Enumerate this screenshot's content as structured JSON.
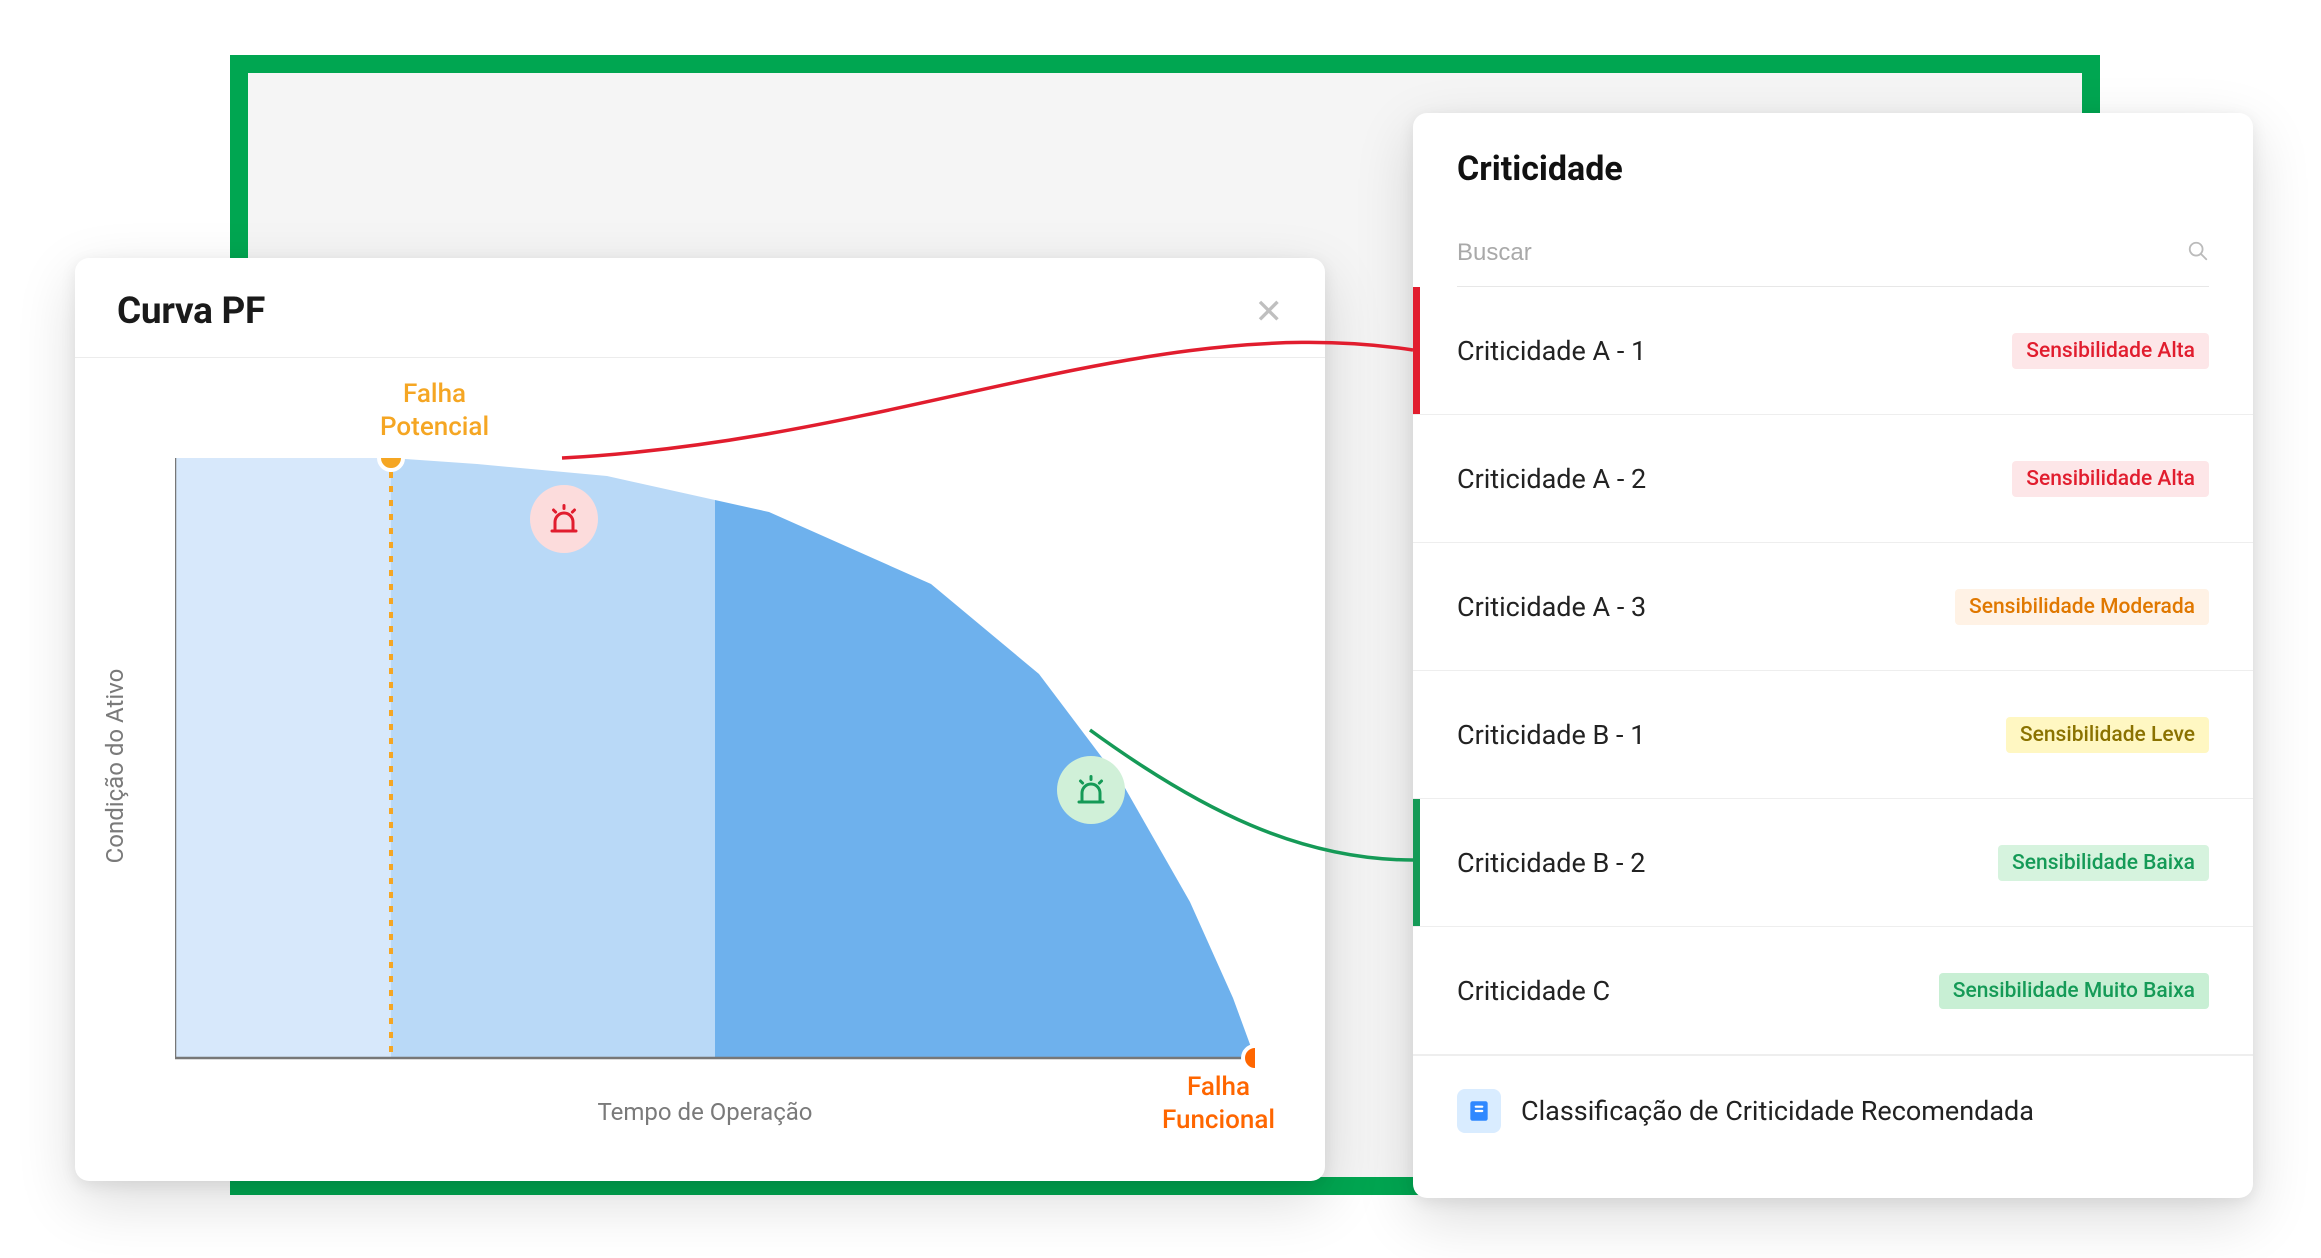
{
  "pf_card": {
    "title": "Curva PF",
    "close_glyph": "✕",
    "potential_failure_label": "Falha\nPotencial",
    "functional_failure_label": "Falha\nFuncional",
    "y_axis_label": "Condição do Ativo",
    "x_axis_label": "Tempo de Operação"
  },
  "criticality": {
    "title": "Criticidade",
    "search_placeholder": "Buscar",
    "items": [
      {
        "label": "Criticidade A - 1",
        "badge": "Sensibilidade Alta",
        "badge_class": "badge-alta",
        "selected_bar": "sel-red"
      },
      {
        "label": "Criticidade A - 2",
        "badge": "Sensibilidade Alta",
        "badge_class": "badge-alta",
        "selected_bar": ""
      },
      {
        "label": "Criticidade A - 3",
        "badge": "Sensibilidade Moderada",
        "badge_class": "badge-mod",
        "selected_bar": ""
      },
      {
        "label": "Criticidade B - 1",
        "badge": "Sensibilidade Leve",
        "badge_class": "badge-leve",
        "selected_bar": ""
      },
      {
        "label": "Criticidade B - 2",
        "badge": "Sensibilidade Baixa",
        "badge_class": "badge-baixa",
        "selected_bar": "sel-green"
      },
      {
        "label": "Criticidade C",
        "badge": "Sensibilidade Muito Baixa",
        "badge_class": "badge-mbaixa",
        "selected_bar": ""
      }
    ],
    "footer_text": "Classificação de Criticidade Recomendada"
  },
  "chart_data": {
    "type": "area",
    "title": "Curva PF",
    "xlabel": "Tempo de Operação",
    "ylabel": "Condição do Ativo",
    "description": "P-F curve: asset condition over operating time, showing potential failure point and functional failure point, with two alert markers.",
    "x_range_normalized": [
      0,
      1
    ],
    "y_range_normalized": [
      0,
      1
    ],
    "series": [
      {
        "name": "Condição do Ativo",
        "x": [
          0.0,
          0.2,
          0.28,
          0.4,
          0.55,
          0.7,
          0.8,
          0.88,
          0.94,
          0.98,
          1.0
        ],
        "y": [
          1.0,
          1.0,
          0.99,
          0.97,
          0.91,
          0.79,
          0.64,
          0.45,
          0.26,
          0.1,
          0.0
        ]
      }
    ],
    "shaded_regions": [
      {
        "x_from": 0.0,
        "x_to": 0.2,
        "fill": "#d7e8fb"
      },
      {
        "x_from": 0.2,
        "x_to": 0.5,
        "fill": "#b9d9f7"
      },
      {
        "x_from": 0.5,
        "x_to": 1.0,
        "fill": "#6eb1ed"
      }
    ],
    "markers": [
      {
        "name": "Falha Potencial",
        "x": 0.2,
        "y": 1.0,
        "color": "#f5a623"
      },
      {
        "name": "Alerta alto (siren)",
        "x": 0.3,
        "y": 0.99,
        "color": "#e11d2e"
      },
      {
        "name": "Alerta baixo (siren)",
        "x": 0.84,
        "y": 0.52,
        "color": "#159a57"
      },
      {
        "name": "Falha Funcional",
        "x": 1.0,
        "y": 0.0,
        "color": "#ff6600"
      }
    ],
    "connections": [
      {
        "from_marker": "Alerta alto (siren)",
        "to_list_item": "Criticidade A - 1",
        "color": "#e11d2e"
      },
      {
        "from_marker": "Alerta baixo (siren)",
        "to_list_item": "Criticidade B - 2",
        "color": "#159a57"
      }
    ]
  }
}
